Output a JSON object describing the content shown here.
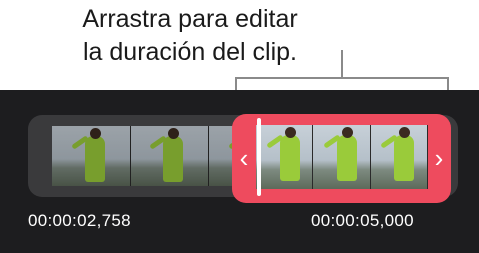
{
  "callout": {
    "line1": "Arrastra para editar",
    "line2": "la duración del clip."
  },
  "selection": {
    "left_handle_icon": "chevron-left-icon",
    "right_handle_icon": "chevron-right-icon",
    "left_glyph": "‹",
    "right_glyph": "›",
    "color": "#ee4b5e"
  },
  "times": {
    "start": "00:00:02,758",
    "end": "00:00:05,000"
  },
  "colors": {
    "background": "#1d1d1f",
    "track": "#3a3a3c",
    "accent": "#ee4b5e"
  }
}
